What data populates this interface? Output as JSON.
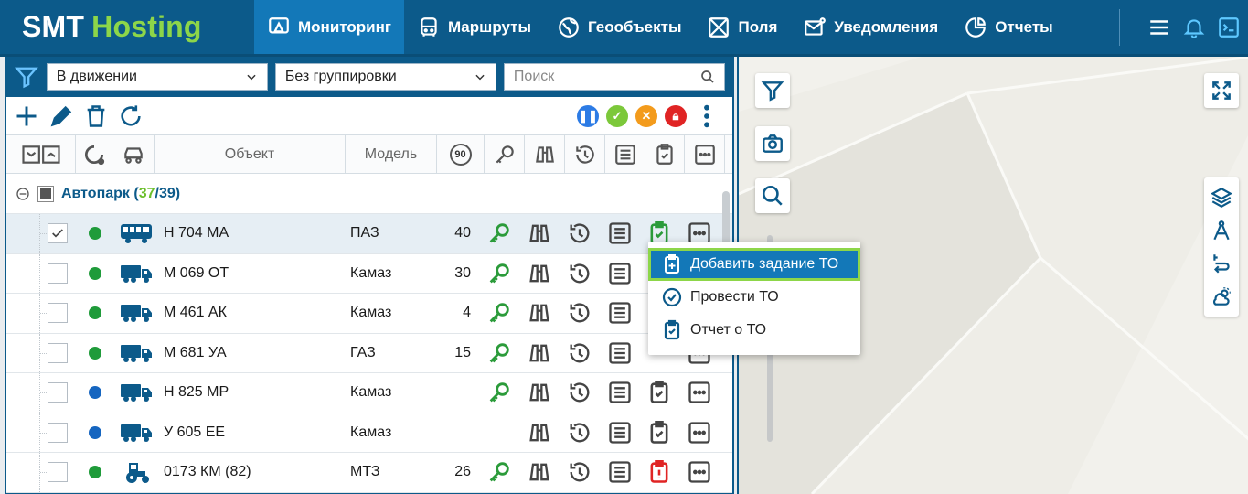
{
  "header": {
    "brand_main": "SMT",
    "brand_accent": "Hosting",
    "nav": [
      {
        "label": "Мониторинг",
        "icon": "monitor-icon",
        "active": true
      },
      {
        "label": "Маршруты",
        "icon": "bus-icon"
      },
      {
        "label": "Геообъекты",
        "icon": "globe-icon"
      },
      {
        "label": "Поля",
        "icon": "field-icon"
      },
      {
        "label": "Уведомления",
        "icon": "mail-icon"
      },
      {
        "label": "Отчеты",
        "icon": "report-icon"
      }
    ]
  },
  "filters": {
    "state_value": "В движении",
    "group_value": "Без группировки",
    "search_placeholder": "Поиск"
  },
  "columns": {
    "object": "Объект",
    "model": "Модель",
    "speed_badge": "90"
  },
  "group": {
    "name": "Автопарк",
    "active": "37",
    "total": "39"
  },
  "rows": [
    {
      "name": "Н 704 МА",
      "model": "ПАЗ",
      "speed": "40",
      "status": "#1f9b3a",
      "vehicle": "bus-icon",
      "key": true,
      "checked": true,
      "to": "green"
    },
    {
      "name": "М 069 ОТ",
      "model": "Камаз",
      "speed": "30",
      "status": "#1f9b3a",
      "vehicle": "truck-icon",
      "key": true,
      "checked": false,
      "to": "none"
    },
    {
      "name": "М 461 АК",
      "model": "Камаз",
      "speed": "4",
      "status": "#1f9b3a",
      "vehicle": "truck-icon",
      "key": true,
      "checked": false,
      "to": "none"
    },
    {
      "name": "М 681 УА",
      "model": "ГАЗ",
      "speed": "15",
      "status": "#1f9b3a",
      "vehicle": "truck-icon",
      "key": true,
      "checked": false,
      "to": "none"
    },
    {
      "name": "Н 825 МР",
      "model": "Камаз",
      "speed": "",
      "status": "#1565c0",
      "vehicle": "truck-icon",
      "key": true,
      "checked": false,
      "to": "gray"
    },
    {
      "name": "У 605 ЕЕ",
      "model": "Камаз",
      "speed": "",
      "status": "#1565c0",
      "vehicle": "truck-icon",
      "key": false,
      "checked": false,
      "to": "gray"
    },
    {
      "name": "0173 КМ (82)",
      "model": "МТЗ",
      "speed": "26",
      "status": "#1f9b3a",
      "vehicle": "tractor-icon",
      "key": true,
      "checked": false,
      "to": "red"
    }
  ],
  "context_menu": {
    "items": [
      {
        "label": "Добавить задание ТО",
        "icon": "clipboard-plus-icon"
      },
      {
        "label": "Провести ТО",
        "icon": "check-circle-icon"
      },
      {
        "label": "Отчет о ТО",
        "icon": "clipboard-check-icon"
      }
    ]
  },
  "colors": {
    "brand": "#0c5a8a",
    "accent": "#8dd649",
    "active_nav": "#1378b8"
  }
}
